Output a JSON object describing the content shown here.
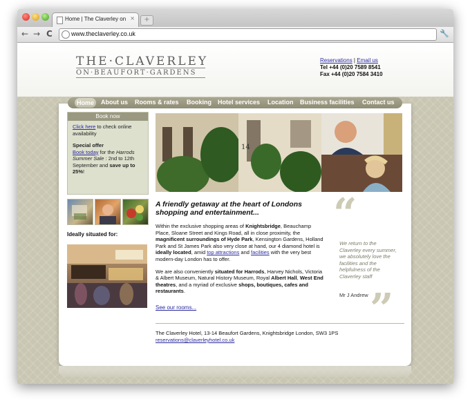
{
  "browser": {
    "tab_title": "Home | The Claverley on Beaufort Gardens",
    "tab_close": "×",
    "new_tab": "+",
    "back": "←",
    "forward": "→",
    "reload": "C",
    "url": "www.theclaverley.co.uk",
    "wrench": "🔧"
  },
  "header": {
    "logo_line1": "THE·CLAVERLEY",
    "logo_line2": "ON·BEAUFORT·GARDENS",
    "reservations_link": "Reservations",
    "separator": "|",
    "email_link": "Email us",
    "tel": "Tel +44 (0)20 7589 8541",
    "fax": "Fax +44 (0)20 7584 3410"
  },
  "nav": {
    "items": [
      "Home",
      "About us",
      "Rooms & rates",
      "Booking",
      "Hotel services",
      "Location",
      "Business facilities",
      "Contact us"
    ]
  },
  "booking": {
    "title": "Book now",
    "click_link": "Click here",
    "click_text": " to check online availability",
    "special_title": "Special offer",
    "book_link": "Book today",
    "offer_text1": " for the ",
    "offer_em": "Harrods Summer Sale",
    "offer_text2": " : 2nd to 12th September and ",
    "offer_save": "save up to 25%",
    "offer_end": "!"
  },
  "ideally": "Ideally situated for:",
  "article": {
    "heading": "A friendly getaway at the heart of Londons shopping and entertainment...",
    "p1_a": "Within the exclusive shopping areas of ",
    "p1_b": "Knightsbridge",
    "p1_c": ", Beauchamp Place, Sloane Street and Kings Road, all in close proximity, the ",
    "p1_d": "magnificent surroundings of Hyde Park",
    "p1_e": ", Kensington Gardens, Holland Park and St James Park also very close at hand, our 4 diamond hotel is ",
    "p1_f": "ideally located",
    "p1_g": ", amid ",
    "p1_link1": "top attractions",
    "p1_h": " and ",
    "p1_link2": "facilities",
    "p1_i": " with the very best modern-day London has to offer.",
    "p2_a": "We are also conveniently ",
    "p2_b": "situated for Harrods",
    "p2_c": ", Harvey Nichols, Victoria & Albert Museum, Natural History Museum, Royal ",
    "p2_d": "Albert Hall",
    "p2_e": ", ",
    "p2_f": "West End theatres",
    "p2_g": ", and a myriad of exclusive ",
    "p2_h": "shops, boutiques, cafes and restaurants",
    "p2_i": ".",
    "see_rooms": "See our rooms..."
  },
  "testimonial": {
    "open": "“",
    "close": "”",
    "text": "We return to the Claverley every summer, we absolutely love the facilities and the helpfulness of the Claverley staff",
    "author": "Mr J Andrew"
  },
  "footer": {
    "address": "The Claverley Hotel, 13-14 Beaufort Gardens, Knightsbridge London, SW3 1PS",
    "email": "reservations@claverleyhotel.co.uk"
  },
  "hero_number": "14"
}
